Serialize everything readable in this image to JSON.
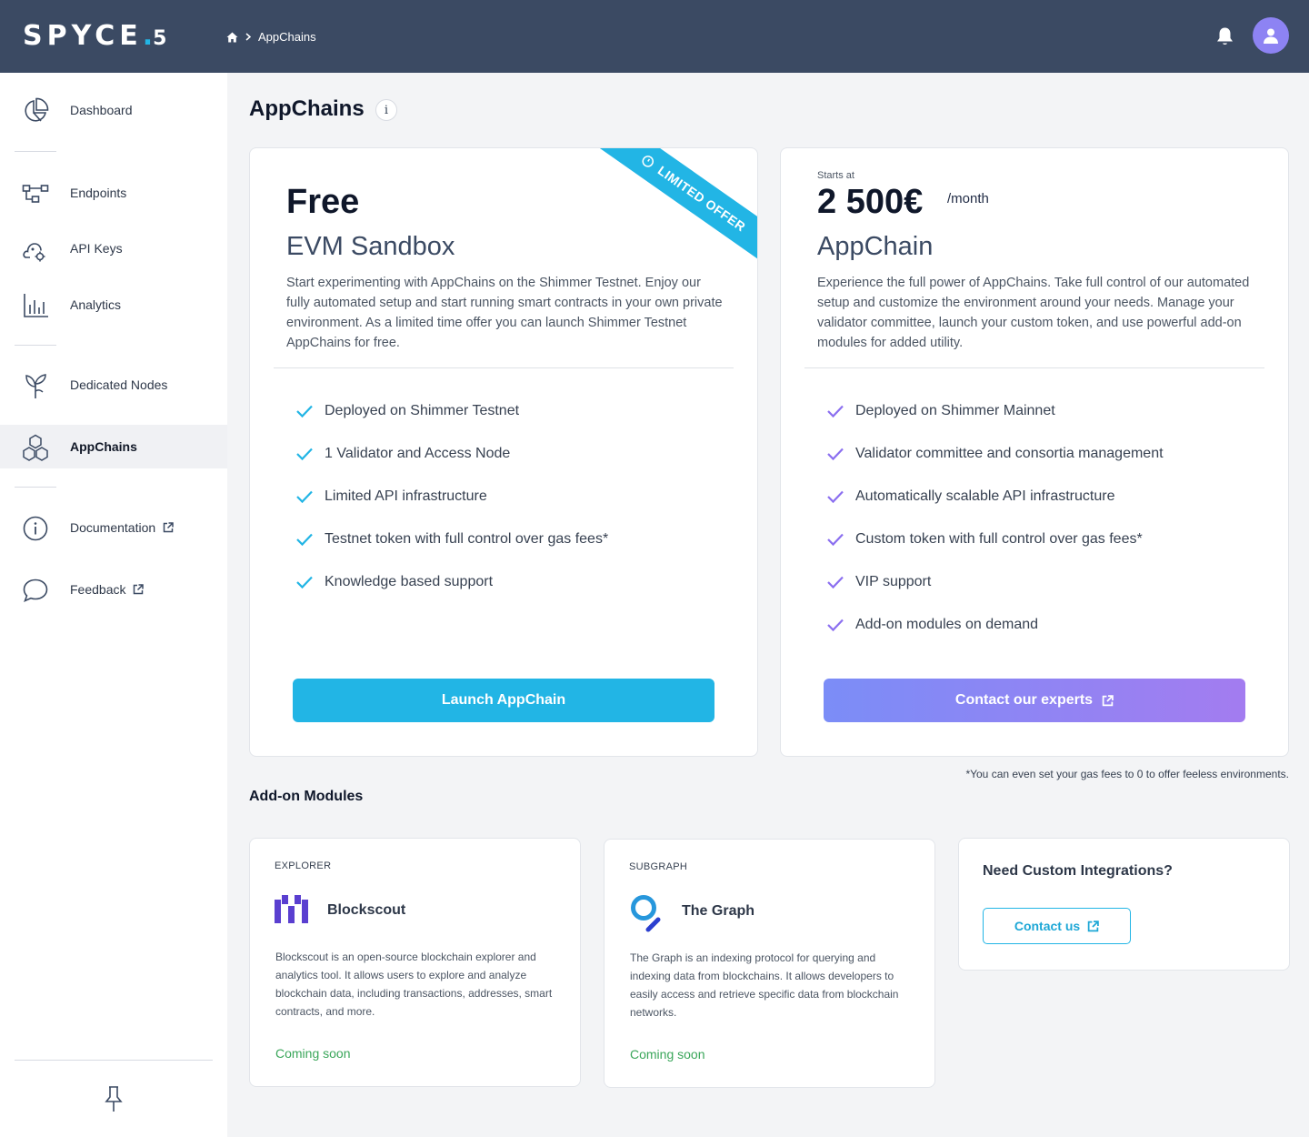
{
  "header": {
    "logo_text": "SPYCE",
    "logo_dot": ".",
    "logo_suffix": "5",
    "breadcrumb_current": "AppChains"
  },
  "sidebar": {
    "items": [
      {
        "label": "Dashboard",
        "icon": "pie-chart-icon"
      },
      {
        "label": "Endpoints",
        "icon": "network-icon"
      },
      {
        "label": "API Keys",
        "icon": "cloud-gear-icon"
      },
      {
        "label": "Analytics",
        "icon": "bar-chart-icon"
      },
      {
        "label": "Dedicated Nodes",
        "icon": "plant-icon"
      },
      {
        "label": "AppChains",
        "icon": "hexagons-icon",
        "active": true
      },
      {
        "label": "Documentation",
        "icon": "info-circle-icon",
        "external": true
      },
      {
        "label": "Feedback",
        "icon": "chat-bubble-icon",
        "external": true
      }
    ]
  },
  "page": {
    "title": "AppChains",
    "info_glyph": "i"
  },
  "plans": {
    "free": {
      "price": "Free",
      "name": "EVM Sandbox",
      "ribbon": "LIMITED OFFER",
      "description": "Start experimenting with AppChains on the Shimmer Testnet. Enjoy our fully automated setup and start running smart contracts in your own private environment. As a limited time offer you can launch Shimmer Testnet AppChains for free.",
      "features": [
        "Deployed on Shimmer Testnet",
        "1 Validator and Access Node",
        "Limited API infrastructure",
        "Testnet token with full control over gas fees*",
        "Knowledge based support"
      ],
      "button": "Launch AppChain",
      "accent": "#22b5e5"
    },
    "appchain": {
      "starts_at": "Starts at",
      "price": "2 500€",
      "period": "/month",
      "name": "AppChain",
      "description": "Experience the full power of AppChains. Take full control of our automated setup and customize the environment around your needs. Manage your validator committee, launch your custom token, and use powerful add-on modules for added utility.",
      "features": [
        "Deployed on Shimmer Mainnet",
        "Validator committee and consortia management",
        "Automatically scalable API infrastructure",
        "Custom token with full control over gas fees*",
        "VIP support",
        "Add-on modules on demand"
      ],
      "button": "Contact our experts",
      "accent": "#8b6ff0"
    }
  },
  "footnote": "*You can even set your gas fees to 0 to offer feeless environments.",
  "addons": {
    "title": "Add-on Modules",
    "modules": [
      {
        "tag": "EXPLORER",
        "name": "Blockscout",
        "description": "Blockscout is an open-source blockchain explorer and analytics tool. It allows users to explore and analyze blockchain data, including transactions, addresses, smart contracts, and more.",
        "status": "Coming soon"
      },
      {
        "tag": "SUBGRAPH",
        "name": "The Graph",
        "description": "The Graph is an indexing protocol for querying and indexing data from blockchains. It allows developers to easily access and retrieve specific data from blockchain networks.",
        "status": "Coming soon"
      }
    ],
    "custom": {
      "title": "Need Custom Integrations?",
      "button": "Contact us"
    }
  }
}
